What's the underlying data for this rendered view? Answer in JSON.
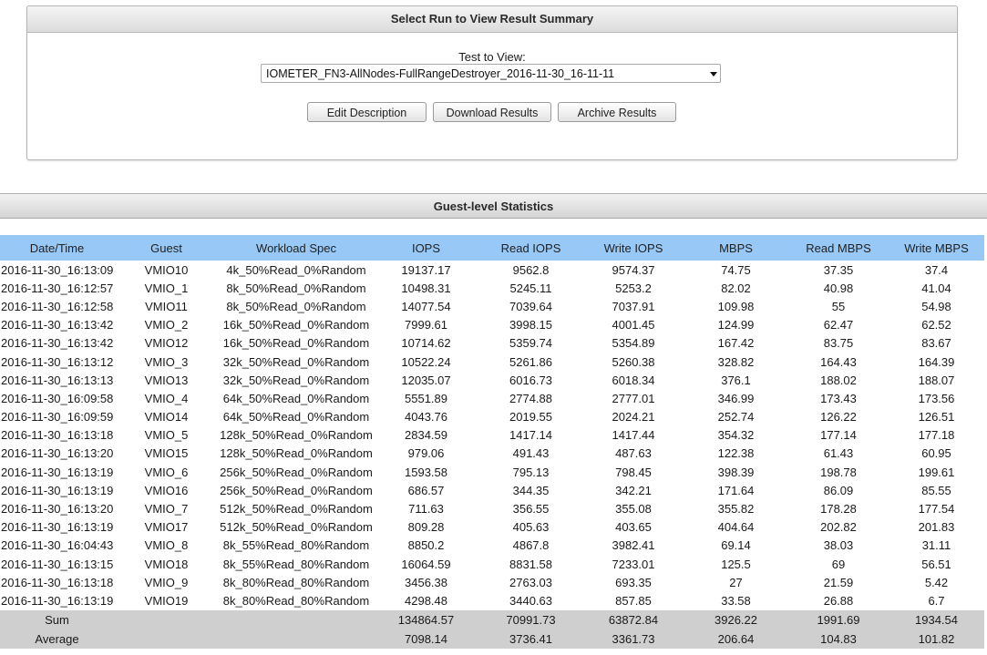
{
  "panel": {
    "title": "Select Run to View Result Summary",
    "test_label": "Test to View:",
    "selected_test": "IOMETER_FN3-AllNodes-FullRangeDestroyer_2016-11-30_16-11-11",
    "buttons": {
      "edit": "Edit Description",
      "download": "Download Results",
      "archive": "Archive Results"
    }
  },
  "stats": {
    "title": "Guest-level Statistics",
    "columns": [
      "Date/Time",
      "Guest",
      "Workload Spec",
      "IOPS",
      "Read IOPS",
      "Write IOPS",
      "MBPS",
      "Read MBPS",
      "Write MBPS"
    ],
    "rows": [
      [
        "2016-11-30_16:13:09",
        "VMIO10",
        "4k_50%Read_0%Random",
        "19137.17",
        "9562.8",
        "9574.37",
        "74.75",
        "37.35",
        "37.4"
      ],
      [
        "2016-11-30_16:12:57",
        "VMIO_1",
        "8k_50%Read_0%Random",
        "10498.31",
        "5245.11",
        "5253.2",
        "82.02",
        "40.98",
        "41.04"
      ],
      [
        "2016-11-30_16:12:58",
        "VMIO11",
        "8k_50%Read_0%Random",
        "14077.54",
        "7039.64",
        "7037.91",
        "109.98",
        "55",
        "54.98"
      ],
      [
        "2016-11-30_16:13:42",
        "VMIO_2",
        "16k_50%Read_0%Random",
        "7999.61",
        "3998.15",
        "4001.45",
        "124.99",
        "62.47",
        "62.52"
      ],
      [
        "2016-11-30_16:13:42",
        "VMIO12",
        "16k_50%Read_0%Random",
        "10714.62",
        "5359.74",
        "5354.89",
        "167.42",
        "83.75",
        "83.67"
      ],
      [
        "2016-11-30_16:13:12",
        "VMIO_3",
        "32k_50%Read_0%Random",
        "10522.24",
        "5261.86",
        "5260.38",
        "328.82",
        "164.43",
        "164.39"
      ],
      [
        "2016-11-30_16:13:13",
        "VMIO13",
        "32k_50%Read_0%Random",
        "12035.07",
        "6016.73",
        "6018.34",
        "376.1",
        "188.02",
        "188.07"
      ],
      [
        "2016-11-30_16:09:58",
        "VMIO_4",
        "64k_50%Read_0%Random",
        "5551.89",
        "2774.88",
        "2777.01",
        "346.99",
        "173.43",
        "173.56"
      ],
      [
        "2016-11-30_16:09:59",
        "VMIO14",
        "64k_50%Read_0%Random",
        "4043.76",
        "2019.55",
        "2024.21",
        "252.74",
        "126.22",
        "126.51"
      ],
      [
        "2016-11-30_16:13:18",
        "VMIO_5",
        "128k_50%Read_0%Random",
        "2834.59",
        "1417.14",
        "1417.44",
        "354.32",
        "177.14",
        "177.18"
      ],
      [
        "2016-11-30_16:13:20",
        "VMIO15",
        "128k_50%Read_0%Random",
        "979.06",
        "491.43",
        "487.63",
        "122.38",
        "61.43",
        "60.95"
      ],
      [
        "2016-11-30_16:13:19",
        "VMIO_6",
        "256k_50%Read_0%Random",
        "1593.58",
        "795.13",
        "798.45",
        "398.39",
        "198.78",
        "199.61"
      ],
      [
        "2016-11-30_16:13:19",
        "VMIO16",
        "256k_50%Read_0%Random",
        "686.57",
        "344.35",
        "342.21",
        "171.64",
        "86.09",
        "85.55"
      ],
      [
        "2016-11-30_16:13:20",
        "VMIO_7",
        "512k_50%Read_0%Random",
        "711.63",
        "356.55",
        "355.08",
        "355.82",
        "178.28",
        "177.54"
      ],
      [
        "2016-11-30_16:13:19",
        "VMIO17",
        "512k_50%Read_0%Random",
        "809.28",
        "405.63",
        "403.65",
        "404.64",
        "202.82",
        "201.83"
      ],
      [
        "2016-11-30_16:04:43",
        "VMIO_8",
        "8k_55%Read_80%Random",
        "8850.2",
        "4867.8",
        "3982.41",
        "69.14",
        "38.03",
        "31.11"
      ],
      [
        "2016-11-30_16:13:15",
        "VMIO18",
        "8k_55%Read_80%Random",
        "16064.59",
        "8831.58",
        "7233.01",
        "125.5",
        "69",
        "56.51"
      ],
      [
        "2016-11-30_16:13:18",
        "VMIO_9",
        "8k_80%Read_80%Random",
        "3456.38",
        "2763.03",
        "693.35",
        "27",
        "21.59",
        "5.42"
      ],
      [
        "2016-11-30_16:13:19",
        "VMIO19",
        "8k_80%Read_80%Random",
        "4298.48",
        "3440.63",
        "857.85",
        "33.58",
        "26.88",
        "6.7"
      ]
    ],
    "summary": [
      [
        "Sum",
        "",
        "",
        "134864.57",
        "70991.73",
        "63872.84",
        "3926.22",
        "1991.69",
        "1934.54"
      ],
      [
        "Average",
        "",
        "",
        "7098.14",
        "3736.41",
        "3361.73",
        "206.64",
        "104.83",
        "101.82"
      ]
    ]
  }
}
